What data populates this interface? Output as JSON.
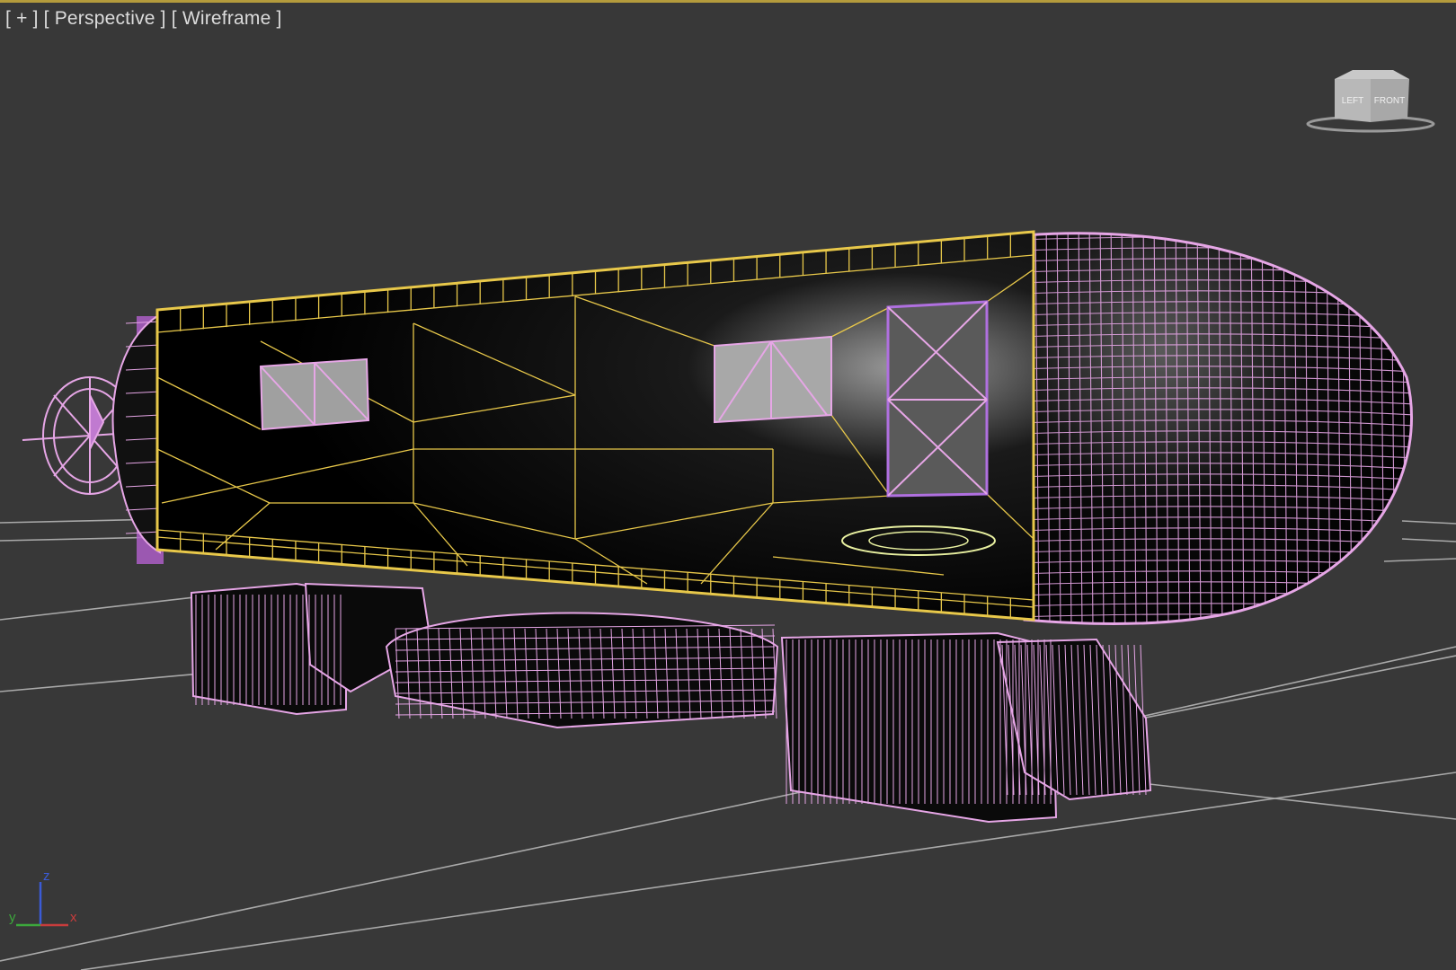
{
  "viewport": {
    "label_plus": "[ + ]",
    "label_view": "[ Perspective ]",
    "label_shading": "[ Wireframe ]",
    "background": "#383838",
    "border_color": "#b49b3c"
  },
  "viewcube": {
    "left_face": "LEFT",
    "front_face": "FRONT"
  },
  "axis": {
    "z": "z",
    "y": "y",
    "x": "x",
    "z_color": "#3b5bd6",
    "y_color": "#3ca83c",
    "x_color": "#c83c3c"
  },
  "scene": {
    "selected_wire_color": "#e8c84a",
    "unselected_wire_color": "#e6a6e6",
    "grid_color": "#bdbdbd",
    "objects": [
      "fuselage-body",
      "nose-cone",
      "tail-propeller",
      "landing-skids",
      "window-panels"
    ]
  }
}
